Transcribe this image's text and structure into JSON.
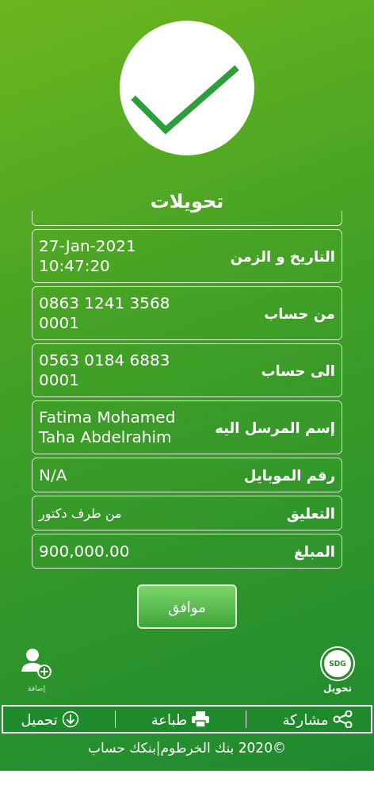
{
  "title": "تحويلات",
  "details": [
    {
      "label": "التاريخ و الزمن",
      "value": "27-Jan-2021 10:47:20"
    },
    {
      "label": "من حساب",
      "value": "0863 1241 3568 0001"
    },
    {
      "label": "الى حساب",
      "value": "0563 0184 6883 0001"
    },
    {
      "label": "إسم المرسل اليه",
      "value": "Fatima Mohamed Taha Abdelrahim"
    },
    {
      "label": "رقم الموبايل",
      "value": "N/A"
    },
    {
      "label": "التعليق",
      "value": "من طرف دكتور"
    },
    {
      "label": "المبلغ",
      "value": "900,000.00"
    }
  ],
  "confirm_button": "موافق",
  "shortcuts": [
    {
      "kind": "transfer",
      "badge": "SDG",
      "label": "تحويل"
    },
    {
      "kind": "add",
      "label": "إضافة"
    }
  ],
  "actions": [
    {
      "kind": "share",
      "label": "مشاركة"
    },
    {
      "kind": "print",
      "label": "طباعة"
    },
    {
      "kind": "download",
      "label": "تحميل"
    }
  ],
  "footer": "©2020 بنك الخرطوم|بنكك حساب"
}
